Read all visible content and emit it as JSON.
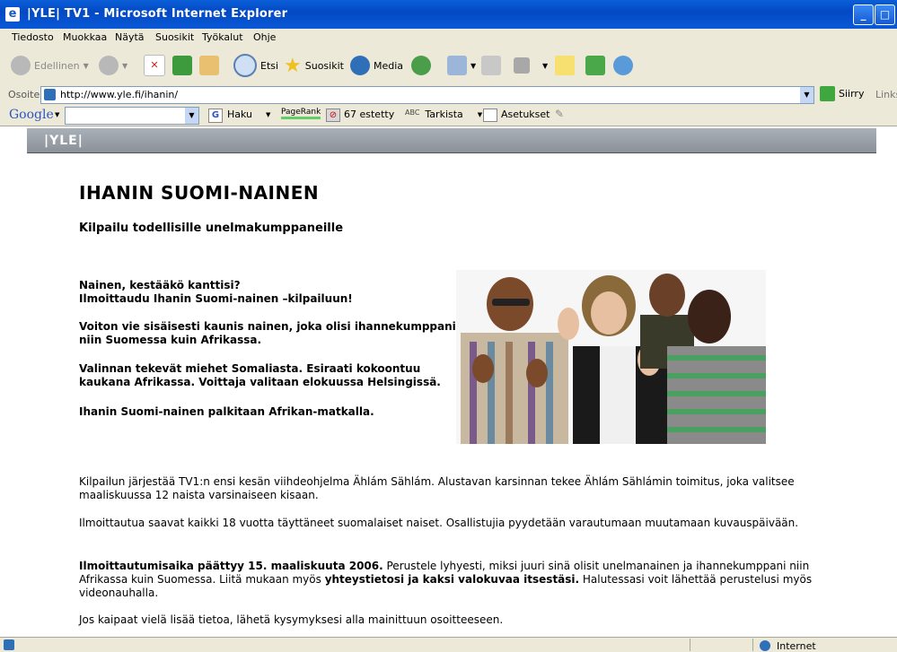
{
  "window": {
    "title": "|YLE| TV1 - Microsoft Internet Explorer"
  },
  "menu": [
    "Tiedosto",
    "Muokkaa",
    "Näytä",
    "Suosikit",
    "Työkalut",
    "Ohje"
  ],
  "toolbar": {
    "back": "Edellinen",
    "search": "Etsi",
    "favorites": "Suosikit",
    "media": "Media"
  },
  "address": {
    "label": "Osoite",
    "url": "http://www.yle.fi/ihanin/",
    "go": "Siirry",
    "links": "Links"
  },
  "google": {
    "logo": "Google",
    "search": "Haku",
    "pagerank": "PageRank",
    "blocked": "67 estetty",
    "spell": "Tarkista",
    "settings": "Asetukset"
  },
  "page": {
    "logo": "|YLE|",
    "title": "IHANIN SUOMI-NAINEN",
    "subtitle": "Kilpailu todellisille unelmakumppaneille",
    "p1a": "Nainen, kestääkö kanttisi?",
    "p1b": "Ilmoittaudu Ihanin Suomi-nainen –kilpailuun!",
    "p2": "Voiton vie sisäisesti kaunis nainen, joka olisi ihannekumppani niin Suomessa kuin Afrikassa.",
    "p3": "Valinnan tekevät miehet Somaliasta. Esiraati kokoontuu kaukana Afrikassa. Voittaja valitaan elokuussa Helsingissä.",
    "p4": "Ihanin Suomi-nainen palkitaan Afrikan-matkalla.",
    "p5": "Kilpailun järjestää TV1:n ensi kesän viihdeohjelma Ählám Sählám. Alustavan karsinnan tekee Ählám Sählámin toimitus, joka valitsee maaliskuussa 12 naista varsinaiseen kisaan.",
    "p6": "Ilmoittautua saavat kaikki 18 vuotta täyttäneet suomalaiset naiset. Osallistujia pyydetään varautumaan muutamaan kuvauspäivään.",
    "p7_bold1": "Ilmoittautumisaika päättyy 15. maaliskuuta 2006.",
    "p7_text1": " Perustele lyhyesti, miksi juuri sinä olisit unelmanainen ja ihannekumppani niin Afrikassa kuin Suomessa. Liitä mukaan myös ",
    "p7_bold2": "yhteystietosi ja kaksi valokuvaa itsestäsi.",
    "p7_text2": " Halutessasi voit lähettää perustelusi myös videonauhalla.",
    "p8": "Jos kaipaat vielä lisää tietoa, lähetä kysymyksesi alla mainittuun osoitteeseen."
  },
  "status": {
    "zone": "Internet"
  }
}
